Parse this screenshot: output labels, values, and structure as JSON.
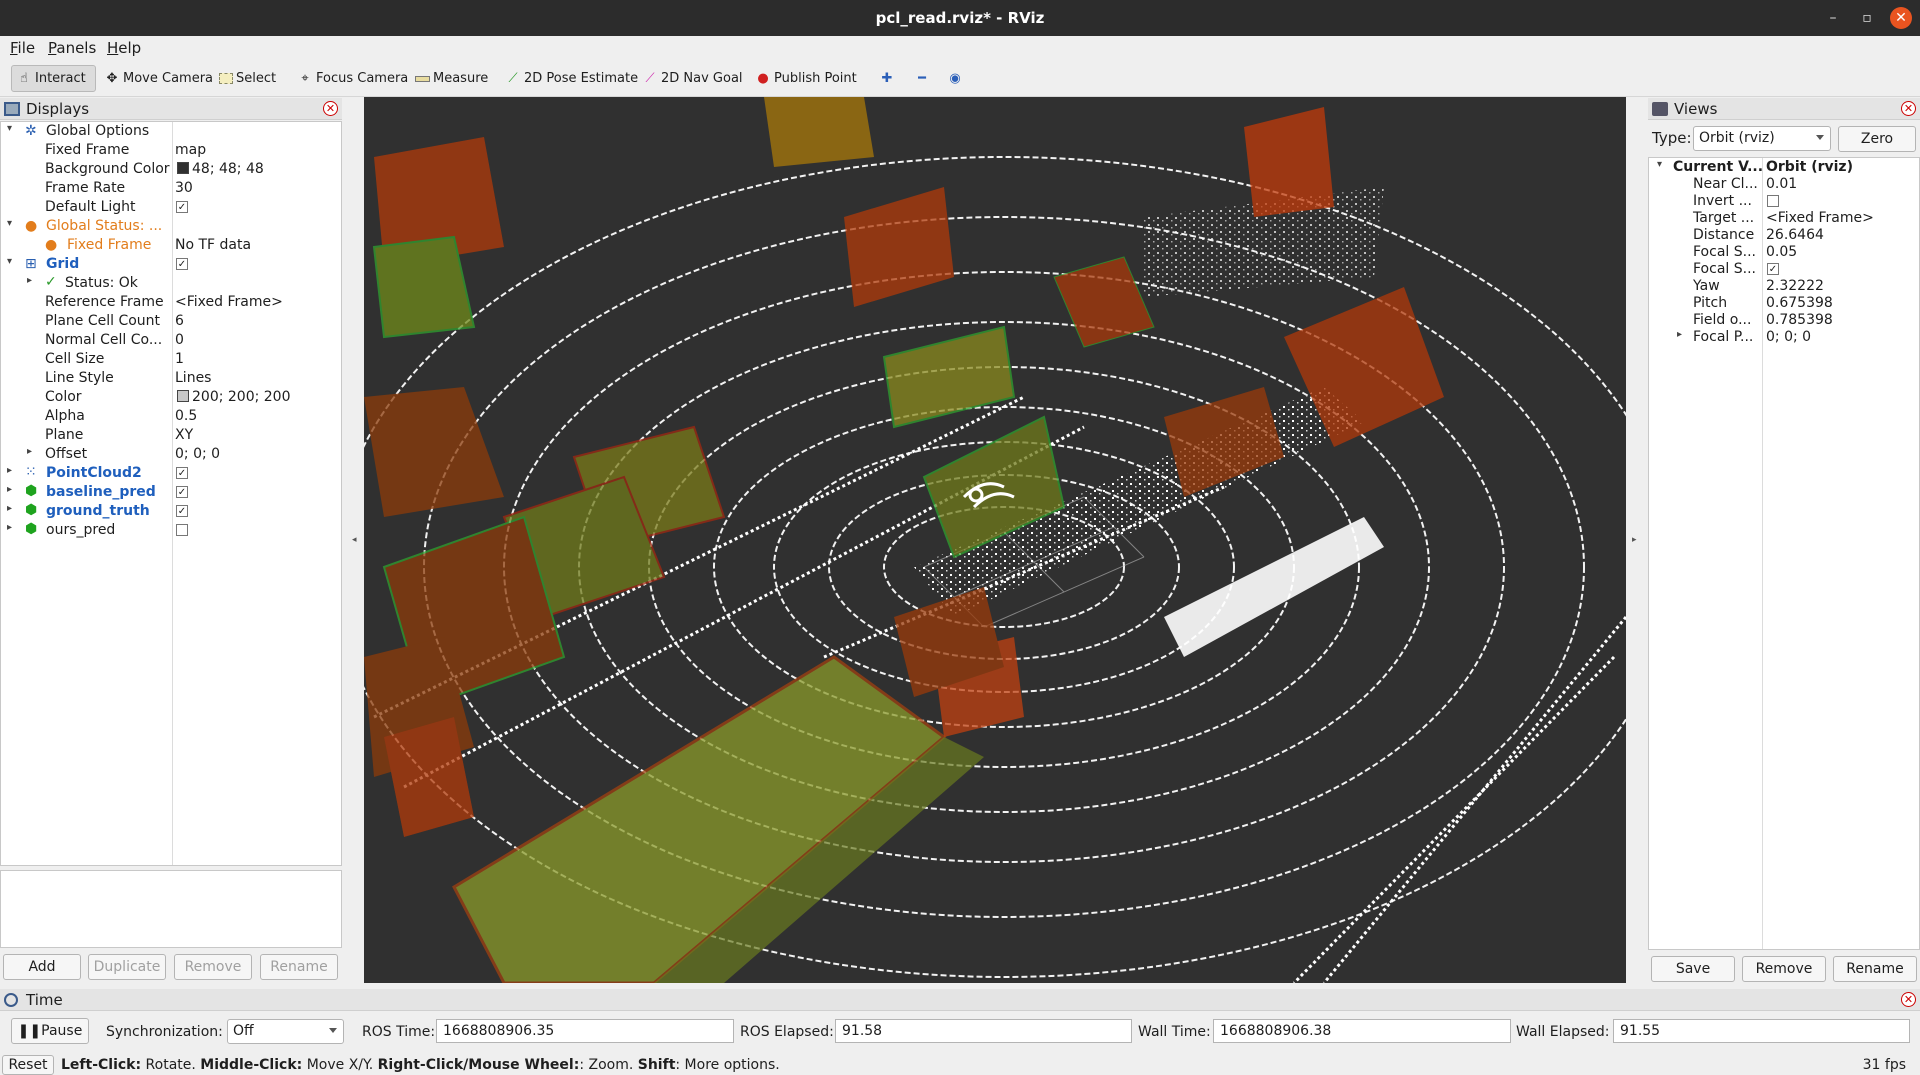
{
  "window": {
    "title": "pcl_read.rviz* - RViz",
    "minimize": "–",
    "maximize": "▫",
    "close": "✕"
  },
  "menu": {
    "file_u": "F",
    "file_rest": "ile",
    "panels_u": "P",
    "panels_rest": "anels",
    "help_u": "H",
    "help_rest": "elp"
  },
  "toolbar": {
    "interact": "Interact",
    "move_camera": "Move Camera",
    "select": "Select",
    "focus_camera": "Focus Camera",
    "measure": "Measure",
    "pose_estimate": "2D Pose Estimate",
    "nav_goal": "2D Nav Goal",
    "publish_point": "Publish Point"
  },
  "displays": {
    "title": "Displays",
    "rows": [
      {
        "k": "Global Options"
      },
      {
        "k": "Fixed Frame",
        "v": "map"
      },
      {
        "k": "Background Color",
        "v": "48; 48; 48"
      },
      {
        "k": "Frame Rate",
        "v": "30"
      },
      {
        "k": "Default Light"
      },
      {
        "k": "Global Status: ..."
      },
      {
        "k": "Fixed Frame",
        "v": "No TF data"
      },
      {
        "k": "Grid"
      },
      {
        "k": "Status: Ok"
      },
      {
        "k": "Reference Frame",
        "v": "<Fixed Frame>"
      },
      {
        "k": "Plane Cell Count",
        "v": "6"
      },
      {
        "k": "Normal Cell Co...",
        "v": "0"
      },
      {
        "k": "Cell Size",
        "v": "1"
      },
      {
        "k": "Line Style",
        "v": "Lines"
      },
      {
        "k": "Color",
        "v": "200; 200; 200"
      },
      {
        "k": "Alpha",
        "v": "0.5"
      },
      {
        "k": "Plane",
        "v": "XY"
      },
      {
        "k": "Offset",
        "v": "0; 0; 0"
      },
      {
        "k": "PointCloud2"
      },
      {
        "k": "baseline_pred"
      },
      {
        "k": "ground_truth"
      },
      {
        "k": "ours_pred"
      }
    ],
    "buttons": {
      "add": "Add",
      "duplicate": "Duplicate",
      "remove": "Remove",
      "rename": "Rename"
    }
  },
  "views": {
    "title": "Views",
    "type_label": "Type:",
    "type_value": "Orbit (rviz)",
    "zero": "Zero",
    "rows": [
      {
        "k": "Current V...",
        "v": "Orbit (rviz)"
      },
      {
        "k": "Near Cl...",
        "v": "0.01"
      },
      {
        "k": "Invert ..."
      },
      {
        "k": "Target ...",
        "v": "<Fixed Frame>"
      },
      {
        "k": "Distance",
        "v": "26.6464"
      },
      {
        "k": "Focal S...",
        "v": "0.05"
      },
      {
        "k": "Focal S..."
      },
      {
        "k": "Yaw",
        "v": "2.32222"
      },
      {
        "k": "Pitch",
        "v": "0.675398"
      },
      {
        "k": "Field o...",
        "v": "0.785398"
      },
      {
        "k": "Focal P...",
        "v": "0; 0; 0"
      }
    ],
    "buttons": {
      "save": "Save",
      "remove": "Remove",
      "rename": "Rename"
    }
  },
  "time": {
    "title": "Time",
    "pause": "Pause",
    "sync_label": "Synchronization:",
    "sync_value": "Off",
    "ros_time_label": "ROS Time:",
    "ros_time": "1668808906.35",
    "ros_elapsed_label": "ROS Elapsed:",
    "ros_elapsed": "91.58",
    "wall_time_label": "Wall Time:",
    "wall_time": "1668808906.38",
    "wall_elapsed_label": "Wall Elapsed:",
    "wall_elapsed": "91.55"
  },
  "status": {
    "reset": "Reset",
    "left_click": "Left-Click:",
    "rotate": " Rotate. ",
    "middle_click": "Middle-Click:",
    "move": " Move X/Y. ",
    "right_click": "Right-Click/Mouse Wheel:",
    "zoom": ": Zoom. ",
    "shift": "Shift",
    "more": ": More options.",
    "fps": "31 fps"
  }
}
